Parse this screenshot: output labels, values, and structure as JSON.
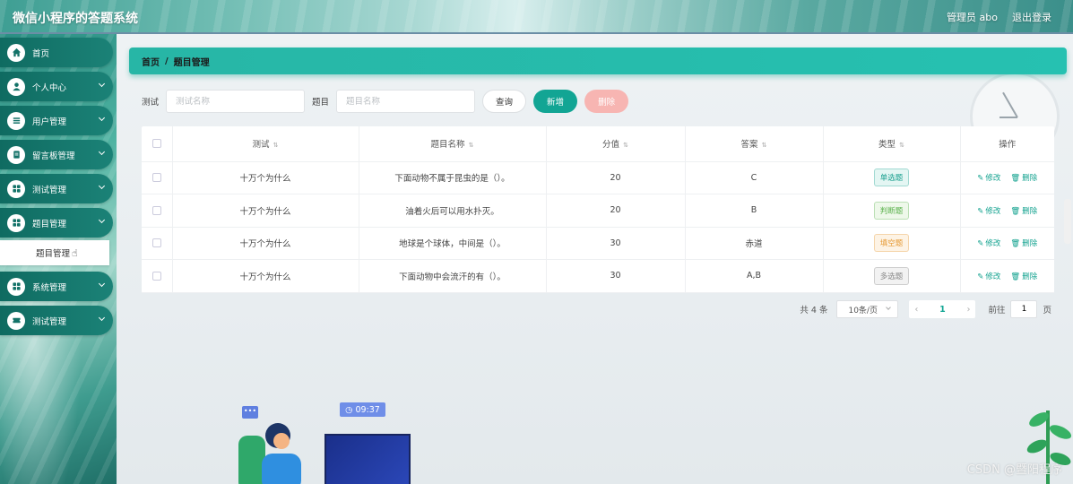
{
  "header": {
    "app_title": "微信小程序的答题系统",
    "user_label": "管理员 abo",
    "logout_label": "退出登录"
  },
  "sidebar": {
    "items": [
      {
        "label": "首页",
        "icon": "home-icon",
        "has_chevron": false
      },
      {
        "label": "个人中心",
        "icon": "user-icon",
        "has_chevron": true
      },
      {
        "label": "用户管理",
        "icon": "list-icon",
        "has_chevron": true
      },
      {
        "label": "留言板管理",
        "icon": "clipboard-icon",
        "has_chevron": true
      },
      {
        "label": "测试管理",
        "icon": "grid-icon",
        "has_chevron": true
      },
      {
        "label": "题目管理",
        "icon": "grid-icon",
        "has_chevron": true
      },
      {
        "label": "系统管理",
        "icon": "grid-icon",
        "has_chevron": true
      },
      {
        "label": "测试管理",
        "icon": "ticket-icon",
        "has_chevron": true
      }
    ],
    "active_sub_item": "题目管理"
  },
  "breadcrumb": {
    "home": "首页",
    "separator": "/",
    "current": "题目管理"
  },
  "search": {
    "test_label": "测试",
    "test_placeholder": "测试名称",
    "question_label": "题目",
    "question_placeholder": "题目名称",
    "query_button": "查询",
    "add_button": "新增",
    "delete_button": "删除"
  },
  "table": {
    "columns": [
      "测试",
      "题目名称",
      "分值",
      "答案",
      "类型",
      "操作"
    ],
    "rows": [
      {
        "test": "十万个为什么",
        "question": "下面动物不属于昆虫的是（）。",
        "score": "20",
        "answer": "C",
        "type": "单选题",
        "type_color": "#1aa08f",
        "type_bg": "#e4f6f3"
      },
      {
        "test": "十万个为什么",
        "question": "油着火后可以用水扑灭。",
        "score": "20",
        "answer": "B",
        "type": "判断题",
        "type_color": "#58b04a",
        "type_bg": "#eef8ea"
      },
      {
        "test": "十万个为什么",
        "question": "地球是个球体，中间是（）。",
        "score": "30",
        "answer": "赤道",
        "type": "填空题",
        "type_color": "#e69a35",
        "type_bg": "#fdf3e5"
      },
      {
        "test": "十万个为什么",
        "question": "下面动物中会流汗的有（）。",
        "score": "30",
        "answer": "A,B",
        "type": "多选题",
        "type_color": "#888888",
        "type_bg": "#f2f2f2"
      }
    ],
    "edit_label": "修改",
    "delete_label": "删除"
  },
  "pagination": {
    "total_label": "共 4 条",
    "page_size": "10条/页",
    "current_page": "1",
    "goto_label": "前往",
    "goto_value": "1",
    "page_suffix": "页"
  },
  "decor": {
    "time_badge": "09:37",
    "watermark": "CSDN @暨阳程序"
  }
}
